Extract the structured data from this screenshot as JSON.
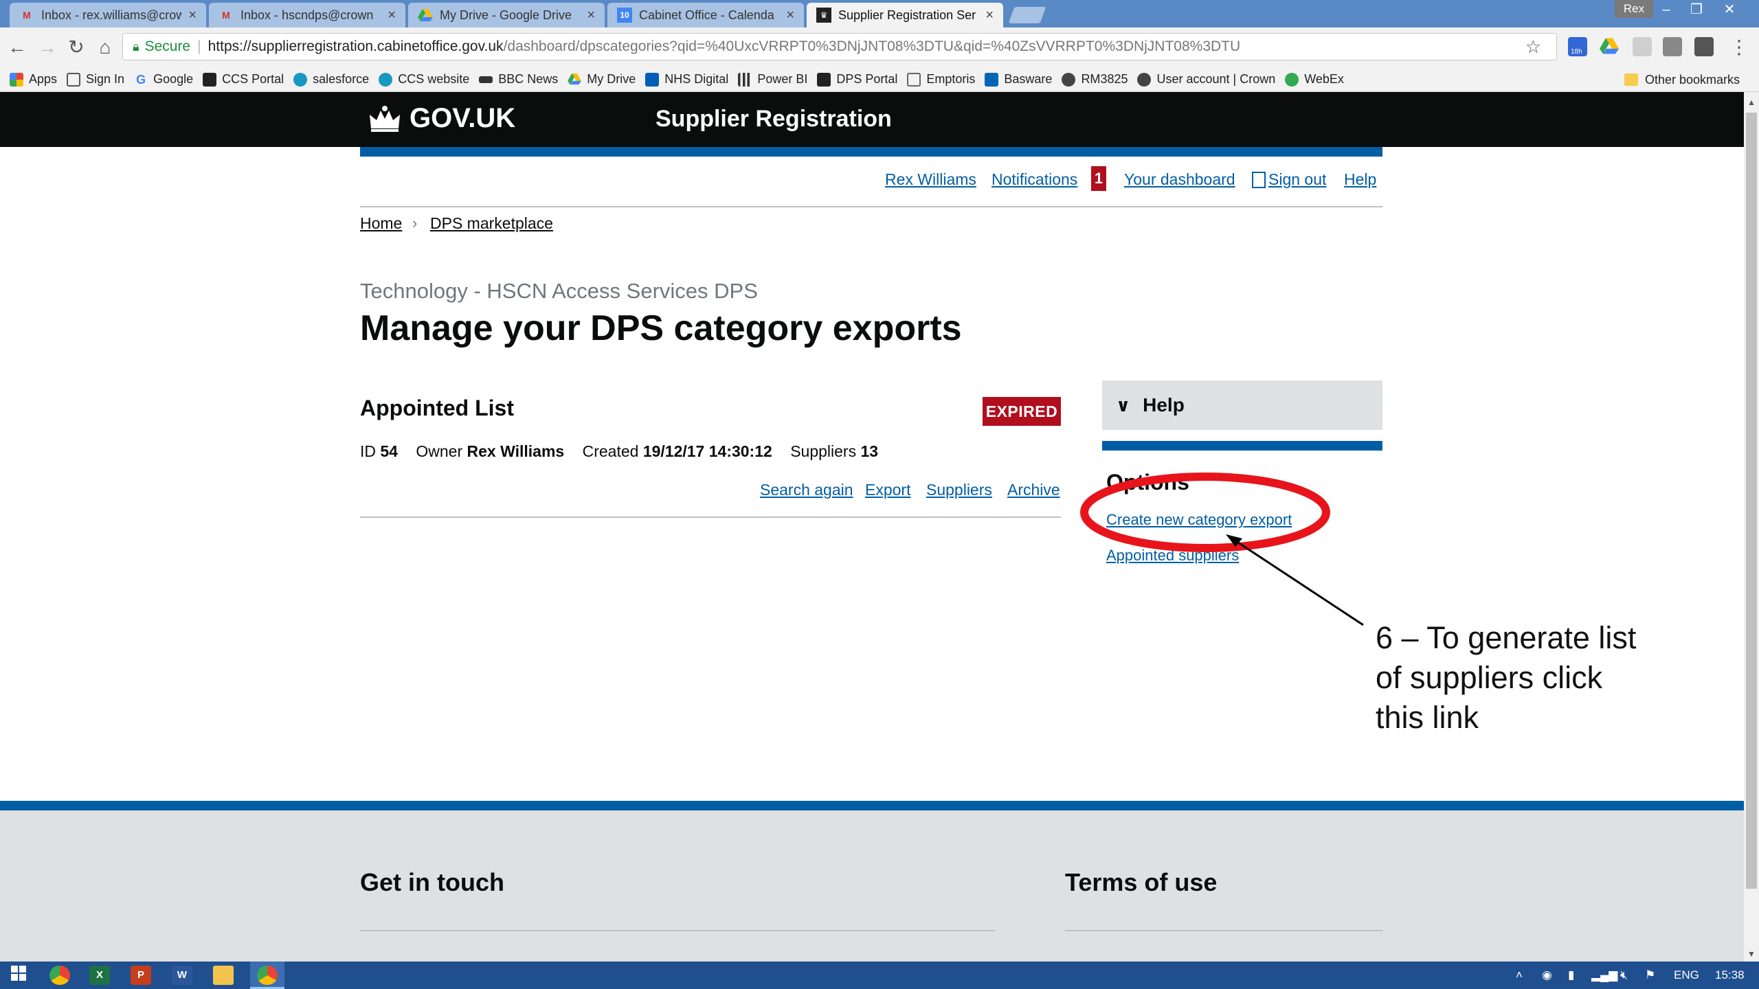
{
  "browser": {
    "tabs": [
      {
        "title": "Inbox - rex.williams@crow",
        "icon": "gmail-icon",
        "active": false
      },
      {
        "title": "Inbox - hscndps@crown",
        "icon": "gmail-icon",
        "active": false
      },
      {
        "title": "My Drive - Google Drive",
        "icon": "google-drive-icon",
        "active": false
      },
      {
        "title": "Cabinet Office - Calenda",
        "icon": "calendar-icon",
        "calendar_day": "10",
        "active": false
      },
      {
        "title": "Supplier Registration Ser",
        "icon": "crown-icon",
        "active": true
      }
    ],
    "profile": "Rex",
    "secure_label": "Secure",
    "url_host": "https://supplierregistration.cabinetoffice.gov.uk",
    "url_path": "/dashboard/dpscategories?qid=%40UxcVRRPT0%3DNjJNT08%3DTU&qid=%40ZsVVRRPT0%3DNjJNT08%3DTU",
    "extension_badge": "18h",
    "bookmarks": [
      {
        "label": "Apps",
        "color": "#e94235"
      },
      {
        "label": "Sign In",
        "color": "#555555"
      },
      {
        "label": "Google",
        "color": "#4285f4"
      },
      {
        "label": "CCS Portal",
        "color": "#222222"
      },
      {
        "label": "salesforce",
        "color": "#1798c1"
      },
      {
        "label": "CCS website",
        "color": "#1798c1"
      },
      {
        "label": "BBC News",
        "color": "#333333"
      },
      {
        "label": "My Drive",
        "color": "#34a853"
      },
      {
        "label": "NHS Digital",
        "color": "#005eb8"
      },
      {
        "label": "Power BI",
        "color": "#333333"
      },
      {
        "label": "DPS Portal",
        "color": "#222222"
      },
      {
        "label": "Emptoris",
        "color": "#666666"
      },
      {
        "label": "Basware",
        "color": "#0066b3"
      },
      {
        "label": "RM3825",
        "color": "#444444"
      },
      {
        "label": "User account | Crown",
        "color": "#444444"
      },
      {
        "label": "WebEx",
        "color": "#34a853"
      }
    ],
    "other_bookmarks": "Other bookmarks"
  },
  "site": {
    "logo_text": "GOV.UK",
    "service_name": "Supplier Registration"
  },
  "topnav": {
    "user": "Rex Williams",
    "notifications": "Notifications",
    "notification_count": "1",
    "dashboard": "Your dashboard",
    "sign_out": "Sign out",
    "help": "Help"
  },
  "breadcrumb": {
    "home": "Home",
    "current": "DPS marketplace"
  },
  "page": {
    "caption": "Technology - HSCN Access Services DPS",
    "title": "Manage your DPS category exports"
  },
  "export_item": {
    "title": "Appointed List",
    "status": "EXPIRED",
    "id_label": "ID",
    "id": "54",
    "owner_label": "Owner",
    "owner": "Rex Williams",
    "created_label": "Created",
    "created": "19/12/17 14:30:12",
    "suppliers_label": "Suppliers",
    "suppliers": "13",
    "actions": {
      "search_again": "Search again",
      "export": "Export",
      "suppliers": "Suppliers",
      "archive": "Archive"
    }
  },
  "sidebar": {
    "help_label": "Help",
    "options_heading": "Options",
    "create_export": "Create new category export",
    "appointed_suppliers": "Appointed suppliers"
  },
  "annotation": {
    "line1": "6 – To generate list",
    "line2": "of suppliers click",
    "line3": "this link",
    "color": "#e8141b"
  },
  "footer": {
    "get_in_touch": "Get in touch",
    "terms_of_use": "Terms of use"
  },
  "taskbar": {
    "language": "ENG",
    "time": "15:38"
  },
  "colors": {
    "govuk_blue": "#005ea5",
    "govuk_black": "#0b0c0c",
    "expired_red": "#b10e1e",
    "link": "#005ea5"
  }
}
